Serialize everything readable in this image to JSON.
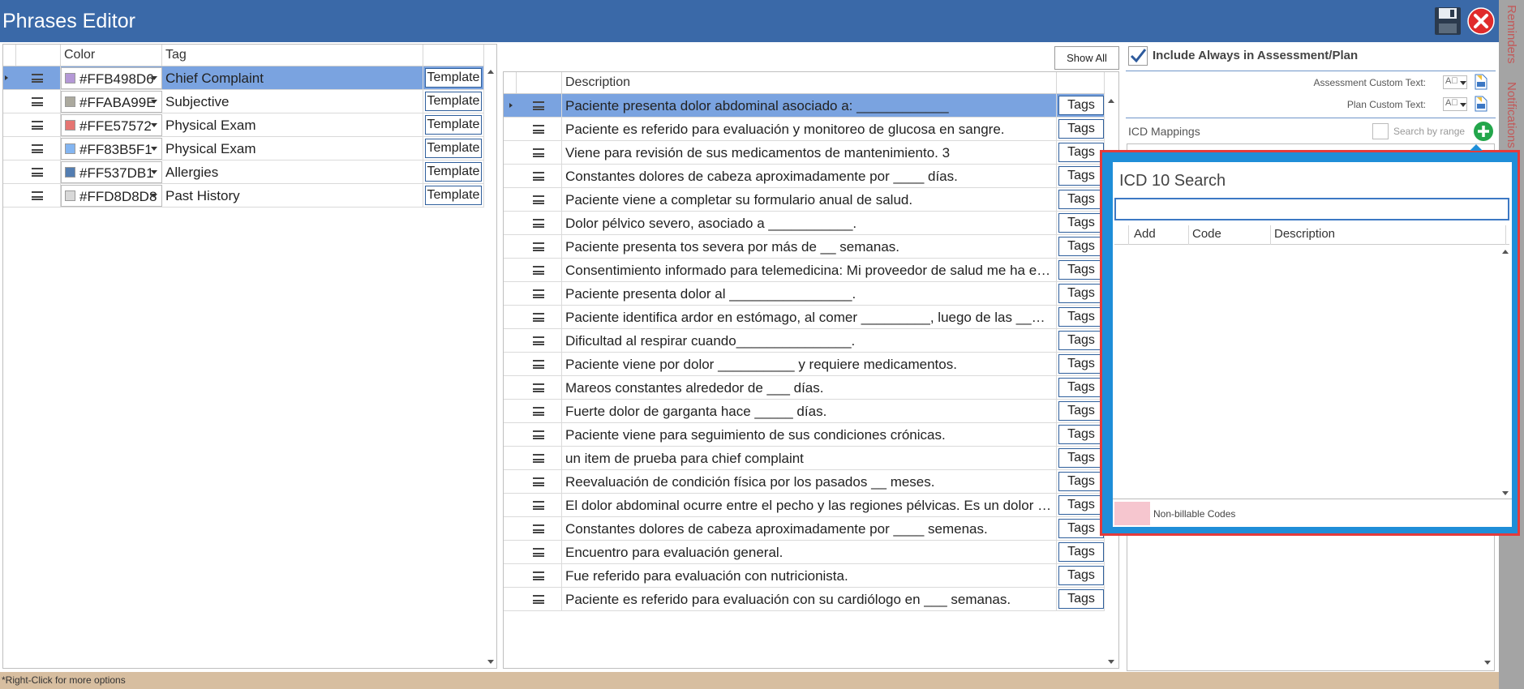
{
  "window": {
    "title": "Phrases Editor",
    "status_text": "*Right-Click for more options"
  },
  "sidebar_tabs": [
    "Reminders",
    "Notifications"
  ],
  "tags_grid": {
    "columns": [
      "Color",
      "Tag",
      ""
    ],
    "rows": [
      {
        "color": "#FFB498D6",
        "swatch": "#b498d6",
        "tag": "Chief Complaint",
        "button": "Template",
        "selected": true
      },
      {
        "color": "#FFABA99E",
        "swatch": "#aba99e",
        "tag": "Subjective",
        "button": "Template",
        "selected": false
      },
      {
        "color": "#FFE57572",
        "swatch": "#e57572",
        "tag": "Physical Exam",
        "button": "Template",
        "selected": false
      },
      {
        "color": "#FF83B5F1",
        "swatch": "#83b5f1",
        "tag": "Physical Exam",
        "button": "Template",
        "selected": false
      },
      {
        "color": "#FF537DB1",
        "swatch": "#537db1",
        "tag": "Allergies",
        "button": "Template",
        "selected": false
      },
      {
        "color": "#FFD8D8D8",
        "swatch": "#d8d8d8",
        "tag": "Past History",
        "button": "Template",
        "selected": false
      }
    ]
  },
  "phrases_grid": {
    "show_all_label": "Show All",
    "columns": [
      "Description",
      ""
    ],
    "button_label": "Tags",
    "rows": [
      "Paciente presenta dolor abdominal asociado a: ____________",
      "Paciente es referido para evaluación y monitoreo de glucosa en sangre.",
      "Viene para revisión de sus medicamentos de mantenimiento. 3",
      "Constantes dolores de cabeza aproximadamente por ____ días.",
      "Paciente viene a completar su formulario anual de salud.",
      "Dolor pélvico severo, asociado a ___________.",
      "Paciente presenta tos severa por más de __ semanas.",
      "Consentimiento informado para telemedicina:  Mi proveedor de salud me ha explic...",
      "Paciente presenta dolor al ________________.",
      "Paciente identifica ardor en estómago, al comer _________, luego de las _____ de la t...",
      "Dificultad al respirar cuando_______________.",
      "Paciente viene por dolor __________ y requiere medicamentos.",
      "Mareos constantes alrededor de ___ días.",
      "Fuerte dolor de garganta hace _____ días.",
      "Paciente viene para seguimiento de sus condiciones crónicas.",
      "un item de prueba para chief complaint",
      "Reevaluación de condición física por los pasados __ meses.",
      "El dolor abdominal ocurre entre el pecho y las regiones pélvicas. Es un dolor pareci...",
      "Constantes dolores de cabeza aproximadamente por ____ semenas.",
      "Encuentro para evaluación general.",
      "Fue referido para evaluación con nutricionista.",
      "Paciente es referido para evaluación con su cardiólogo en ___ semanas."
    ]
  },
  "assessment": {
    "include_always_label": "Include Always in Assessment/Plan",
    "include_always_checked": true,
    "assessment_custom_label": "Assessment Custom Text:",
    "plan_custom_label": "Plan Custom Text:",
    "icd_mappings_label": "ICD Mappings",
    "search_by_range_label": "Search by range"
  },
  "icd_search": {
    "title": "ICD 10 Search",
    "search_value": "",
    "columns": [
      "Add",
      "Code",
      "Description"
    ],
    "legend_label": "Non-billable Codes",
    "legend_color": "#f6c6cf"
  },
  "colors": {
    "titlebar": "#3a69a8",
    "selected_row": "#7aa3e0",
    "popup_border": "#e43b3b",
    "popup_frame": "#1f8ed8",
    "sidebar_text": "#c25959",
    "statusbar": "#d7bea0"
  }
}
